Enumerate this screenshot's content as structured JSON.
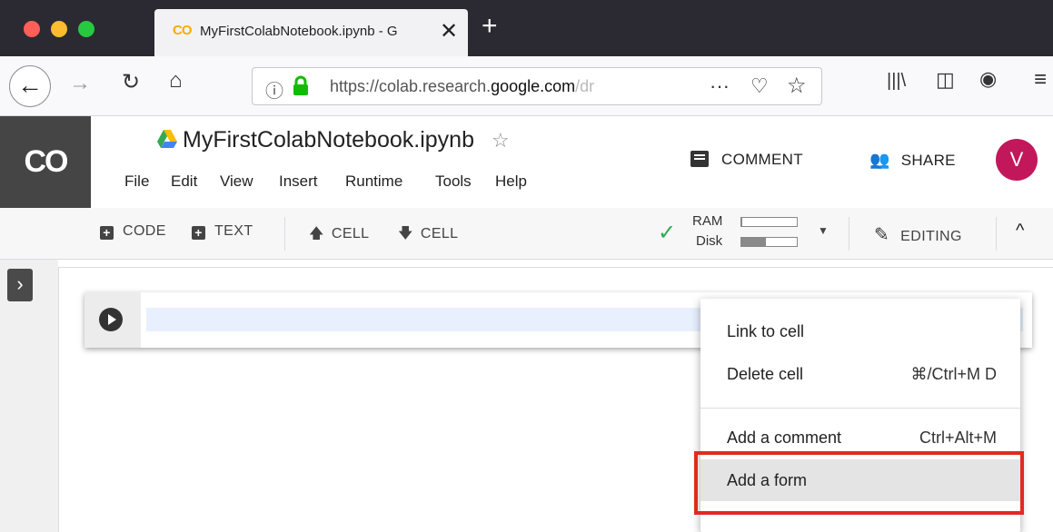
{
  "browser": {
    "tab_title": "MyFirstColabNotebook.ipynb - G",
    "tab_logo": "CO",
    "url_prefix": "https://colab.research.",
    "url_domain": "google.com",
    "url_suffix": "/dr",
    "icons": [
      "back-icon",
      "forward-icon",
      "reload-icon",
      "home-icon",
      "info-icon",
      "lock-icon",
      "more-icon",
      "pocket-icon",
      "star-icon",
      "library-icon",
      "sidebar-icon",
      "account-icon",
      "hamburger-icon"
    ]
  },
  "colab": {
    "logo": "CO",
    "notebook_title": "MyFirstColabNotebook.ipynb",
    "menu": [
      "File",
      "Edit",
      "View",
      "Insert",
      "Runtime",
      "Tools",
      "Help"
    ],
    "comment_label": "COMMENT",
    "share_label": "SHARE",
    "avatar_letter": "V",
    "avatar_color": "#c2185b"
  },
  "toolbar": {
    "code_label": "CODE",
    "text_label": "TEXT",
    "cell_up_label": "CELL",
    "cell_down_label": "CELL",
    "ram_label": "RAM",
    "disk_label": "Disk",
    "ram_usage": 0.02,
    "disk_usage": 0.45,
    "editing_label": "EDITING"
  },
  "context_menu": {
    "items": [
      {
        "label": "Link to cell",
        "shortcut": ""
      },
      {
        "label": "Delete cell",
        "shortcut": "⌘/Ctrl+M D"
      },
      {
        "label": "Add a comment",
        "shortcut": "Ctrl+Alt+M"
      },
      {
        "label": "Add a form",
        "shortcut": ""
      }
    ],
    "highlighted": "Add a form",
    "highlight_color": "#e02b20"
  }
}
